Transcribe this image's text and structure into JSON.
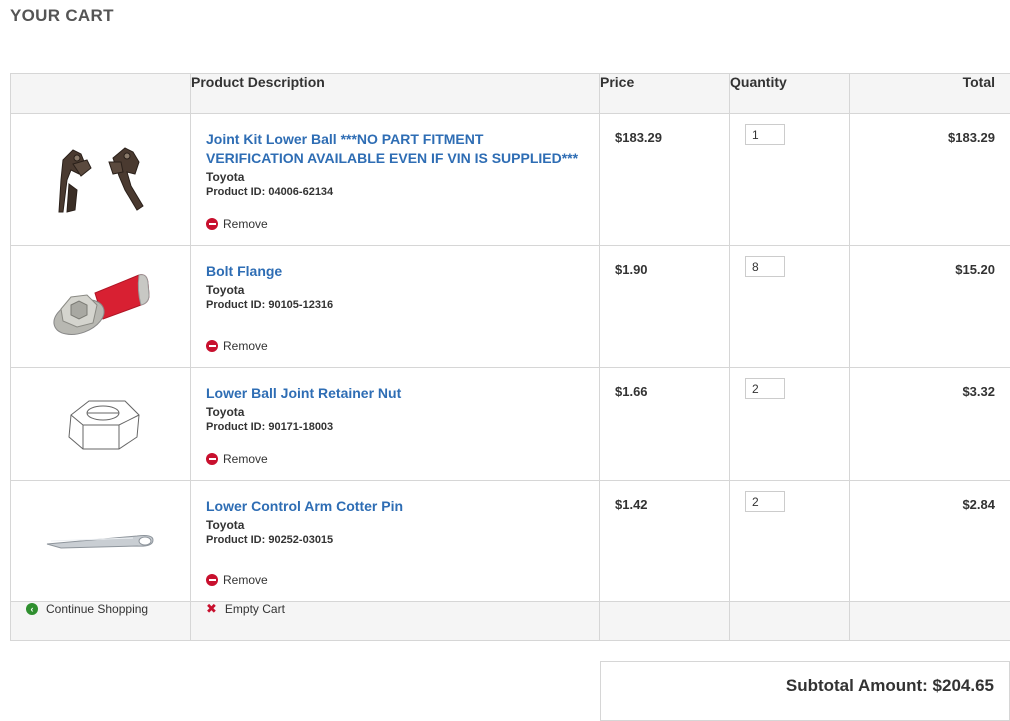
{
  "page": {
    "title": "YOUR CART"
  },
  "table": {
    "headers": {
      "image": "",
      "description": "Product Description",
      "price": "Price",
      "quantity": "Quantity",
      "total": "Total"
    },
    "rows": [
      {
        "name": "Joint Kit Lower Ball ***NO PART FITMENT VERIFICATION AVAILABLE EVEN IF VIN IS SUPPLIED***",
        "brand": "Toyota",
        "product_id": "Product ID: 04006-62134",
        "remove_label": "Remove",
        "price": "$183.29",
        "quantity": "1",
        "total": "$183.29",
        "image_icon": "ball-joint-kit-icon"
      },
      {
        "name": "Bolt Flange",
        "brand": "Toyota",
        "product_id": "Product ID: 90105-12316",
        "remove_label": "Remove",
        "price": "$1.90",
        "quantity": "8",
        "total": "$15.20",
        "image_icon": "flange-bolt-icon"
      },
      {
        "name": "Lower Ball Joint Retainer Nut",
        "brand": "Toyota",
        "product_id": "Product ID: 90171-18003",
        "remove_label": "Remove",
        "price": "$1.66",
        "quantity": "2",
        "total": "$3.32",
        "image_icon": "hex-nut-icon"
      },
      {
        "name": "Lower Control Arm Cotter Pin",
        "brand": "Toyota",
        "product_id": "Product ID: 90252-03015",
        "remove_label": "Remove",
        "price": "$1.42",
        "quantity": "2",
        "total": "$2.84",
        "image_icon": "cotter-pin-icon"
      }
    ],
    "footer": {
      "continue_label": "Continue Shopping",
      "empty_label": "Empty Cart"
    }
  },
  "summary": {
    "subtotal_text": "Subtotal Amount: $204.65"
  },
  "colors": {
    "link": "#2e6db4",
    "remove": "#c8102e",
    "continue": "#2f8f2f"
  }
}
